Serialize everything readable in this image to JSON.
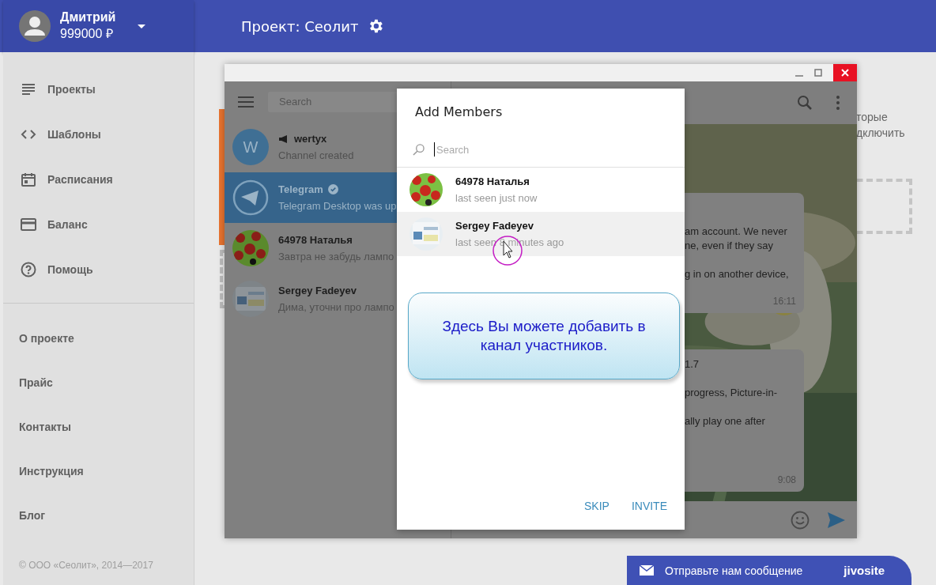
{
  "user": {
    "name": "Дмитрий",
    "balance": "999000 ₽"
  },
  "project": {
    "title": "Проект: Сеолит"
  },
  "sidebar": {
    "items": [
      {
        "label": "Проекты"
      },
      {
        "label": "Шаблоны"
      },
      {
        "label": "Расписания"
      },
      {
        "label": "Баланс"
      },
      {
        "label": "Помощь"
      }
    ],
    "links": [
      "О проекте",
      "Прайс",
      "Контакты",
      "Инструкция",
      "Блог"
    ],
    "copyright": "© ООО «Сеолит», 2014—2017"
  },
  "background_page": {
    "text_fragments": [
      "торые",
      "дключить"
    ]
  },
  "telegram": {
    "search": {
      "placeholder": "Search"
    },
    "chats": [
      {
        "name": "wertyx",
        "kind": "channel",
        "letter": "W",
        "preview": "Channel created",
        "verified": false,
        "selected": false
      },
      {
        "name": "Telegram",
        "kind": "chat",
        "preview": "Telegram Desktop was up",
        "verified": true,
        "selected": true
      },
      {
        "name": "64978 Наталья",
        "kind": "chat",
        "preview": "Завтра не забудь лампо",
        "verified": false,
        "selected": false
      },
      {
        "name": "Sergey Fadeyev",
        "kind": "chat",
        "preview": "Дима, уточни про лампо",
        "verified": false,
        "selected": false
      }
    ],
    "messages": [
      {
        "paragraphs": [
          [
            "am account. We never",
            "ne, even if they say"
          ],
          [
            "g in on another device,"
          ]
        ],
        "time": "16:11"
      },
      {
        "paragraphs": [
          [
            "1.7"
          ],
          [
            "progress, Picture-in-"
          ],
          [
            "ally play one after"
          ]
        ],
        "time": "9:08"
      }
    ]
  },
  "dialog": {
    "title": "Add Members",
    "search": {
      "placeholder": "Search"
    },
    "members": [
      {
        "name": "64978 Наталья",
        "status": "last seen just now",
        "highlighted": false
      },
      {
        "name": "Sergey Fadeyev",
        "status": "last seen 8 minutes ago",
        "highlighted": true
      }
    ],
    "buttons": [
      "SKIP",
      "INVITE"
    ]
  },
  "tooltip": {
    "text": "Здесь Вы можете добавить в канал участников."
  },
  "chat_widget": {
    "label": "Отправьте нам сообщение",
    "brand": "jivosite"
  }
}
